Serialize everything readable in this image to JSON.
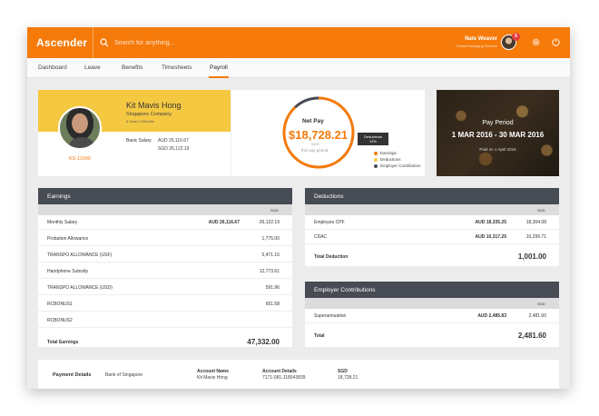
{
  "app": {
    "name": "Ascender"
  },
  "search": {
    "placeholder": "Search for anything..."
  },
  "user": {
    "name": "Nate Weaver",
    "role": "Global Managing Director",
    "notifications": "5"
  },
  "nav": {
    "tabs": [
      "Dashboard",
      "Leave",
      "Benefits",
      "Timesheets",
      "Payroll"
    ],
    "active": "Payroll"
  },
  "profile": {
    "name": "Kit Mavis Hong",
    "company": "Singapore Company",
    "tenure": "6 Years 3 Months",
    "id": "KS-11000",
    "basic_salary_label": "Basic Salary",
    "basic_salary_aud": "AUD 26,116.67",
    "basic_salary_sgd": "SGD 26,122.19"
  },
  "net_pay": {
    "label": "Net Pay",
    "value": "$18,728.21",
    "currency": "SGD",
    "period_text": "this pay period",
    "tooltip_title": "Deductions",
    "tooltip_value": "12%",
    "legend": [
      {
        "label": "Earnings",
        "color": "#f57a0a"
      },
      {
        "label": "Deductions",
        "color": "#f5c842"
      },
      {
        "label": "Employer Contribution",
        "color": "#464b54"
      }
    ],
    "deductions_fraction": 0.12
  },
  "pay_period": {
    "label": "Pay Period",
    "range": "1 MAR 2016 - 30 MAR 2016",
    "paid": "Paid on 1 April 2016"
  },
  "earnings": {
    "title": "Earnings",
    "currency_header": "SGD",
    "rows": [
      {
        "label": "Monthly Salary",
        "aud": "AUD 26,116.67",
        "sgd": "26,122.19"
      },
      {
        "label": "Probation Allowance",
        "aud": "",
        "sgd": "1,775.00"
      },
      {
        "label": "TRANSPO ALLOWANCE (USF)",
        "aud": "",
        "sgd": "5,471.16"
      },
      {
        "label": "Handphone Subsidy",
        "aud": "",
        "sgd": "12,773.61"
      },
      {
        "label": "TRANSPO ALLOWANCE (USD)",
        "aud": "",
        "sgd": "591.96"
      },
      {
        "label": "RCBONUS1",
        "aud": "",
        "sgd": "651.58"
      },
      {
        "label": "RCBONUS2",
        "aud": "",
        "sgd": ""
      }
    ],
    "total_label": "Total Earnings",
    "total_value": "47,332.00"
  },
  "deductions": {
    "title": "Deductions",
    "currency_header": "SGD",
    "rows": [
      {
        "label": "Employee CPF",
        "aud": "AUD 18,335.25",
        "sgd": "18,304.08"
      },
      {
        "label": "CDAC",
        "aud": "AUD 10,317.25",
        "sgd": "10,299.71"
      }
    ],
    "total_label": "Total Deduction",
    "total_value": "1,001.00"
  },
  "employer": {
    "title": "Employer Contributions",
    "currency_header": "SGD",
    "rows": [
      {
        "label": "Superannuation",
        "aud": "AUD 2,485.83",
        "sgd": "2,481.60"
      }
    ],
    "total_label": "Total",
    "total_value": "2,481.60"
  },
  "payment": {
    "title": "Payment Details",
    "bank": "Bank of Singapore",
    "account_name_label": "Account Name",
    "account_name": "Kit Mavis Hong",
    "account_details_label": "Account Details",
    "account_details": "7171-081-118043839",
    "sgd_label": "SGD",
    "sgd_value": "18,728.21"
  }
}
